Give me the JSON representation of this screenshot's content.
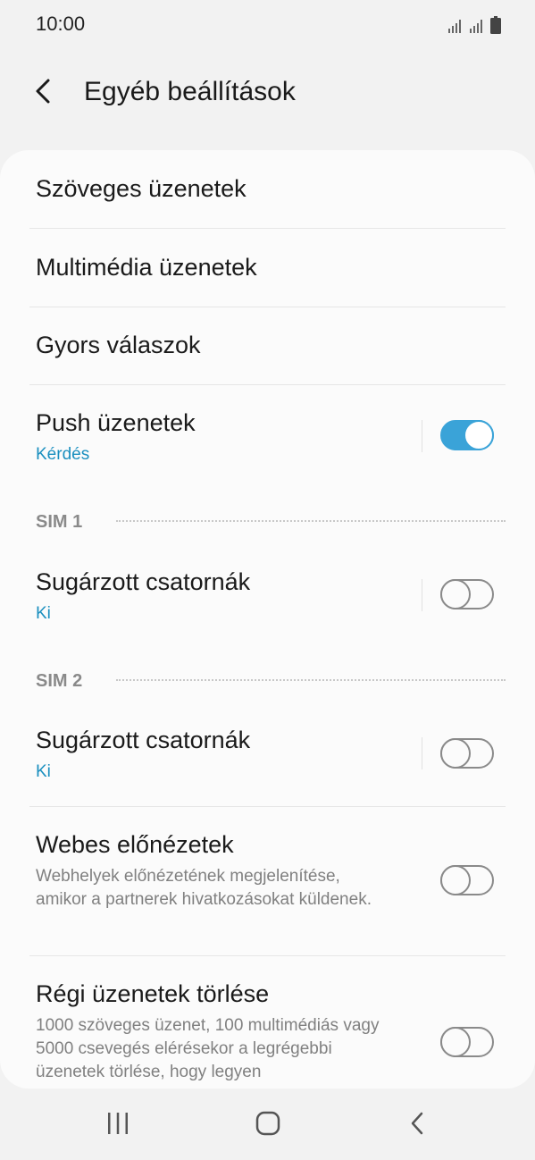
{
  "status_bar": {
    "time": "10:00",
    "icons": [
      "signal-icon",
      "signal-icon",
      "battery-icon"
    ]
  },
  "header": {
    "title": "Egyéb beállítások",
    "back_icon": "back-arrow-icon"
  },
  "items": {
    "text_messages": {
      "title": "Szöveges üzenetek"
    },
    "multimedia_messages": {
      "title": "Multimédia üzenetek"
    },
    "quick_replies": {
      "title": "Gyors válaszok"
    },
    "push_messages": {
      "title": "Push üzenetek",
      "subtitle": "Kérdés",
      "toggle_on": true
    },
    "sim1": {
      "header": "SIM 1"
    },
    "sim1_broadcast": {
      "title": "Sugárzott csatornák",
      "subtitle": "Ki",
      "toggle_on": false
    },
    "sim2": {
      "header": "SIM 2"
    },
    "sim2_broadcast": {
      "title": "Sugárzott csatornák",
      "subtitle": "Ki",
      "toggle_on": false
    },
    "web_previews": {
      "title": "Webes előnézetek",
      "description": "Webhelyek előnézetének megjelenítése, amikor a partnerek hivatkozásokat küldenek.",
      "toggle_on": false
    },
    "delete_old": {
      "title": "Régi üzenetek törlése",
      "description": "1000 szöveges üzenet, 100 multimédiás vagy 5000 csevegés elérésekor a legrégebbi üzenetek törlése, hogy legyen",
      "toggle_on": false
    }
  },
  "navbar": {
    "icons": [
      "recent-apps-icon",
      "home-icon",
      "back-icon"
    ]
  },
  "colors": {
    "accent": "#3aa3d8",
    "subtitle": "#1a8fbf",
    "background": "#f2f2f2",
    "card": "#fbfbfb"
  }
}
